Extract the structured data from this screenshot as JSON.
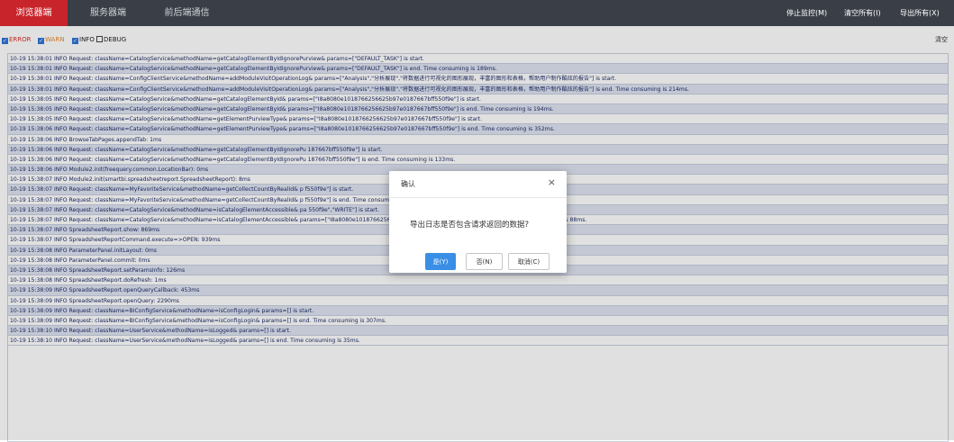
{
  "topbar": {
    "tabs": [
      {
        "label": "浏览器端",
        "active": true
      },
      {
        "label": "服务器端",
        "active": false
      },
      {
        "label": "前后端通信",
        "active": false
      }
    ],
    "actions": {
      "stop_monitor": "停止监控(M)",
      "clear_all": "清空所有(I)",
      "export_all": "导出所有(X)"
    }
  },
  "filters": [
    {
      "label": "ERROR",
      "checked": true,
      "color": "#d9302c"
    },
    {
      "label": "WARN",
      "checked": true,
      "color": "#e8892b"
    },
    {
      "label": "INFO",
      "checked": true,
      "color": "#222222"
    },
    {
      "label": "DEBUG",
      "checked": false,
      "color": "#222222"
    }
  ],
  "clear_label": "清空",
  "log_rows": [
    "10-19 15:38:01 INFO Request: className=CatalogService&methodName=getCatalogElementByIdIgnorePurview& params=[\"DEFAULT_TASK\"] is start.",
    "10-19 15:38:01 INFO Request: className=CatalogService&methodName=getCatalogElementByIdIgnorePurview& params=[\"DEFAULT_TASK\"] is end. Time consuming is 189ms.",
    "10-19 15:38:01 INFO Request: className=ConfigClientService&methodName=addModuleVisitOperationLog& params=[\"Analysis\",\"分析展现\",\"将数据进行可视化的图形展现，丰富的图形和表格，帮助用户制作酷炫的报告\"] is start.",
    "10-19 15:38:01 INFO Request: className=ConfigClientService&methodName=addModuleVisitOperationLog& params=[\"Analysis\",\"分析展现\",\"将数据进行可视化的图形展现，丰富的图形和表格，帮助用户制作酷炫的报告\"] is end. Time consuming is 214ms.",
    "10-19 15:38:05 INFO Request: className=CatalogService&methodName=getCatalogElementById& params=[\"I8a8080e1018766256625b97e0187667bff550f9e\"] is start.",
    "10-19 15:38:05 INFO Request: className=CatalogService&methodName=getCatalogElementById& params=[\"I8a8080e1018766256625b97e0187667bff550f9e\"] is end. Time consuming is 194ms.",
    "10-19 15:38:05 INFO Request: className=CatalogService&methodName=getElementPurviewType& params=[\"I8a8080e1018766256625b97e0187667bff550f9e\"] is start.",
    "10-19 15:38:06 INFO Request: className=CatalogService&methodName=getElementPurviewType& params=[\"I8a8080e1018766256625b97e0187667bff550f9e\"] is end. Time consuming is 352ms.",
    "10-19 15:38:06 INFO BrowseTabPages.appendTab: 1ms",
    "10-19 15:38:06 INFO Request: className=CatalogService&methodName=getCatalogElementByIdIgnorePu                                                                    187667bff550f9e\"] is start.",
    "10-19 15:38:06 INFO Request: className=CatalogService&methodName=getCatalogElementByIdIgnorePu                                                                    187667bff550f9e\"] is end. Time consuming is 133ms.",
    "10-19 15:38:06 INFO Module2.init(freequery.common.LocationBar): 0ms",
    "10-19 15:38:07 INFO Module2.init(smartbi.spreadsheetreport.SpreadsheetReport): 8ms",
    "10-19 15:38:07 INFO Request: className=MyFavoriteService&methodName=getCollectCountByRealId& p                                                                    f550f9e\"] is start.",
    "10-19 15:38:07 INFO Request: className=MyFavoriteService&methodName=getCollectCountByRealId& p                                                                    f550f9e\"] is end. Time consuming is 114ms.",
    "10-19 15:38:07 INFO Request: className=CatalogService&methodName=isCatalogElementAccessible& pa                                                                    550f9e\",\"WRITE\"] is start.",
    "10-19 15:38:07 INFO Request: className=CatalogService&methodName=isCatalogElementAccessible& params=[\"I8a8080e1018766256625b97e0187667bff550f9e\",\"WRITE\"] is end. Time consuming is 88ms.",
    "10-19 15:38:07 INFO SpreadsheetReport.show: 869ms",
    "10-19 15:38:07 INFO SpreadsheetReportCommand.execute=>OPEN: 939ms",
    "10-19 15:38:08 INFO ParameterPanel.initLayout: 0ms",
    "10-19 15:38:08 INFO ParameterPanel.commit: 0ms",
    "10-19 15:38:08 INFO SpreadsheetReport.setParamsInfo: 126ms",
    "10-19 15:38:08 INFO SpreadsheetReport.doRefresh: 1ms",
    "10-19 15:38:09 INFO SpreadsheetReport.openQueryCallback: 453ms",
    "10-19 15:38:09 INFO SpreadsheetReport.openQuery: 2290ms",
    "10-19 15:38:09 INFO Request: className=BIConfigService&methodName=isConfigLogin& params=[] is start.",
    "10-19 15:38:09 INFO Request: className=BIConfigService&methodName=isConfigLogin& params=[] is end. Time consuming is 307ms.",
    "10-19 15:38:10 INFO Request: className=UserService&methodName=isLogged& params=[] is start.",
    "10-19 15:38:10 INFO Request: className=UserService&methodName=isLogged& params=[] is end. Time consuming is 35ms."
  ],
  "dialog": {
    "title": "确认",
    "close_icon": "×",
    "message": "导出日志是否包含请求返回的数据?",
    "yes": "是(Y)",
    "no": "否(N)",
    "cancel": "取消(C)"
  },
  "colors": {
    "topbar_bg": "#3a3f47",
    "active_tab": "#c8242b",
    "row_alt": "#dfe4f2",
    "log_text": "#1d2b66",
    "primary_button": "#3a8ee6"
  }
}
